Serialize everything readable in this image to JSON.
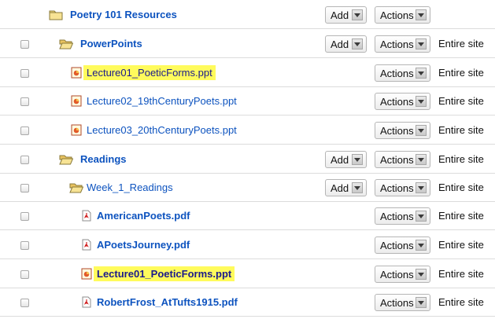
{
  "labels": {
    "add": "Add",
    "actions": "Actions",
    "access": "Entire site"
  },
  "rows": [
    {
      "name": "Poetry 101 Resources",
      "type": "folder",
      "depth": 0,
      "bold": true,
      "highlight": false,
      "checkbox": false,
      "add": true,
      "access": false
    },
    {
      "name": "PowerPoints",
      "type": "folder-open",
      "depth": 1,
      "bold": true,
      "highlight": false,
      "checkbox": true,
      "add": true,
      "access": true
    },
    {
      "name": "Lecture01_PoeticForms.ppt",
      "type": "ppt",
      "depth": 2,
      "bold": false,
      "highlight": true,
      "checkbox": true,
      "add": false,
      "access": true
    },
    {
      "name": "Lecture02_19thCenturyPoets.ppt",
      "type": "ppt",
      "depth": 2,
      "bold": false,
      "highlight": false,
      "checkbox": true,
      "add": false,
      "access": true
    },
    {
      "name": "Lecture03_20thCenturyPoets.ppt",
      "type": "ppt",
      "depth": 2,
      "bold": false,
      "highlight": false,
      "checkbox": true,
      "add": false,
      "access": true
    },
    {
      "name": "Readings",
      "type": "folder-open",
      "depth": 1,
      "bold": true,
      "highlight": false,
      "checkbox": true,
      "add": true,
      "access": true
    },
    {
      "name": "Week_1_Readings",
      "type": "folder-open",
      "depth": 2,
      "bold": false,
      "highlight": false,
      "checkbox": true,
      "add": true,
      "access": true
    },
    {
      "name": "AmericanPoets.pdf",
      "type": "pdf",
      "depth": 3,
      "bold": true,
      "highlight": false,
      "checkbox": true,
      "add": false,
      "access": true
    },
    {
      "name": "APoetsJourney.pdf",
      "type": "pdf",
      "depth": 3,
      "bold": true,
      "highlight": false,
      "checkbox": true,
      "add": false,
      "access": true
    },
    {
      "name": "Lecture01_PoeticForms.ppt",
      "type": "ppt",
      "depth": 3,
      "bold": true,
      "highlight": true,
      "checkbox": true,
      "add": false,
      "access": true
    },
    {
      "name": "RobertFrost_AtTufts1915.pdf",
      "type": "pdf",
      "depth": 3,
      "bold": true,
      "highlight": false,
      "checkbox": true,
      "add": false,
      "access": true
    }
  ]
}
